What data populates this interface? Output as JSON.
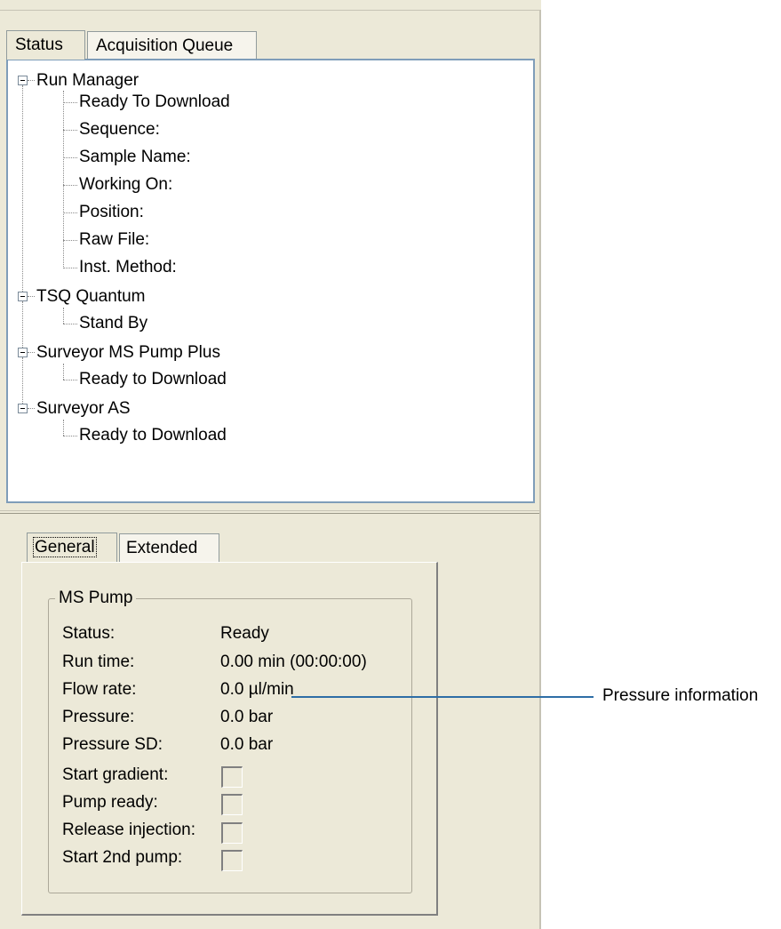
{
  "tabs": [
    "Status",
    "Acquisition Queue"
  ],
  "tree": {
    "run_manager": {
      "label": "Run Manager",
      "children": [
        "Ready To Download",
        "Sequence:",
        "Sample Name:",
        "Working On:",
        "Position:",
        "Raw File:",
        "Inst. Method:"
      ]
    },
    "tsq_quantum": {
      "label": "TSQ Quantum",
      "children": [
        "Stand By"
      ]
    },
    "ms_pump": {
      "label": "Surveyor MS Pump Plus",
      "children": [
        "Ready to Download"
      ]
    },
    "autosampler": {
      "label": "Surveyor AS",
      "children": [
        "Ready to Download"
      ]
    }
  },
  "subtabs": [
    "General",
    "Extended"
  ],
  "group": {
    "title": "MS Pump",
    "rows": [
      {
        "label": "Status:",
        "value": "Ready"
      },
      {
        "label": "Run time:",
        "value": "0.00 min (00:00:00)"
      },
      {
        "label": "Flow rate:",
        "value": "0.0 µl/min"
      },
      {
        "label": "Pressure:",
        "value": "0.0 bar"
      },
      {
        "label": "Pressure SD:",
        "value": "0.0 bar"
      }
    ],
    "checks": [
      {
        "label": "Start gradient:",
        "checked": false
      },
      {
        "label": "Pump ready:",
        "checked": false
      },
      {
        "label": "Release injection:",
        "checked": false
      },
      {
        "label": "Start 2nd pump:",
        "checked": false
      }
    ]
  },
  "callout": "Pressure information"
}
